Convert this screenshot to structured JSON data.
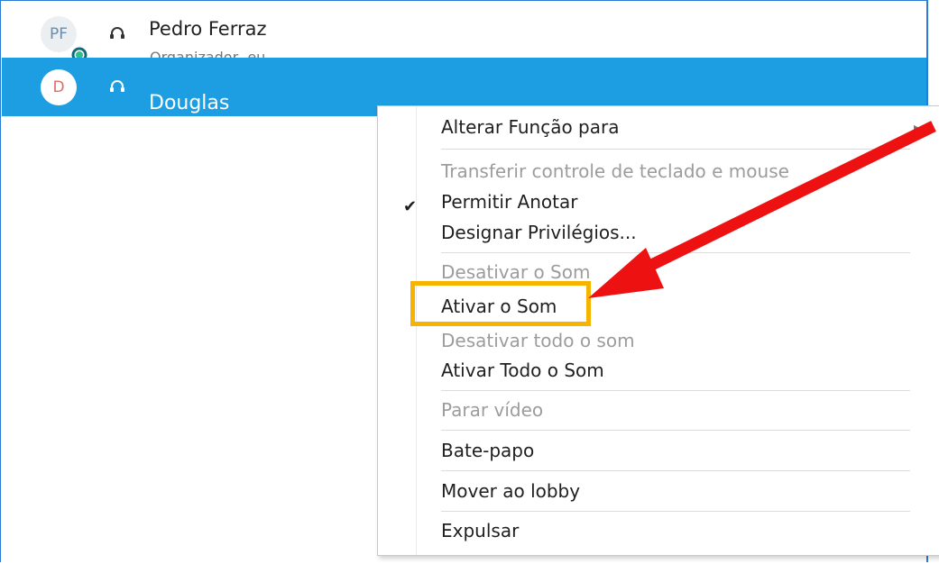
{
  "participants": [
    {
      "initials": "PF",
      "name": "Pedro Ferraz",
      "subtitle": "Organizador, eu"
    },
    {
      "initials": "D",
      "name": "Douglas"
    }
  ],
  "context_menu": {
    "items": [
      {
        "label": "Alterar Função para",
        "enabled": true,
        "has_submenu": true
      },
      {
        "label": "Transferir controle de teclado e mouse",
        "enabled": false
      },
      {
        "label": "Permitir Anotar",
        "enabled": true,
        "checked": true
      },
      {
        "label": "Designar Privilégios...",
        "enabled": true
      },
      {
        "label": "Desativar o Som",
        "enabled": false
      },
      {
        "label": "Ativar o Som",
        "enabled": true,
        "annotated": true
      },
      {
        "label": "Desativar todo o som",
        "enabled": false
      },
      {
        "label": "Ativar Todo o Som",
        "enabled": true
      },
      {
        "label": "Parar vídeo",
        "enabled": false
      },
      {
        "label": "Bate-papo",
        "enabled": true
      },
      {
        "label": "Mover ao lobby",
        "enabled": true
      },
      {
        "label": "Expulsar",
        "enabled": true
      }
    ],
    "check_glyph": "✔",
    "submenu_glyph": "▸"
  },
  "annotation": {
    "highlight_color": "#f6b400",
    "arrow_color": "#ee1111"
  },
  "colors": {
    "selected_row": "#1d9de2",
    "frame": "#2b7bd6"
  }
}
